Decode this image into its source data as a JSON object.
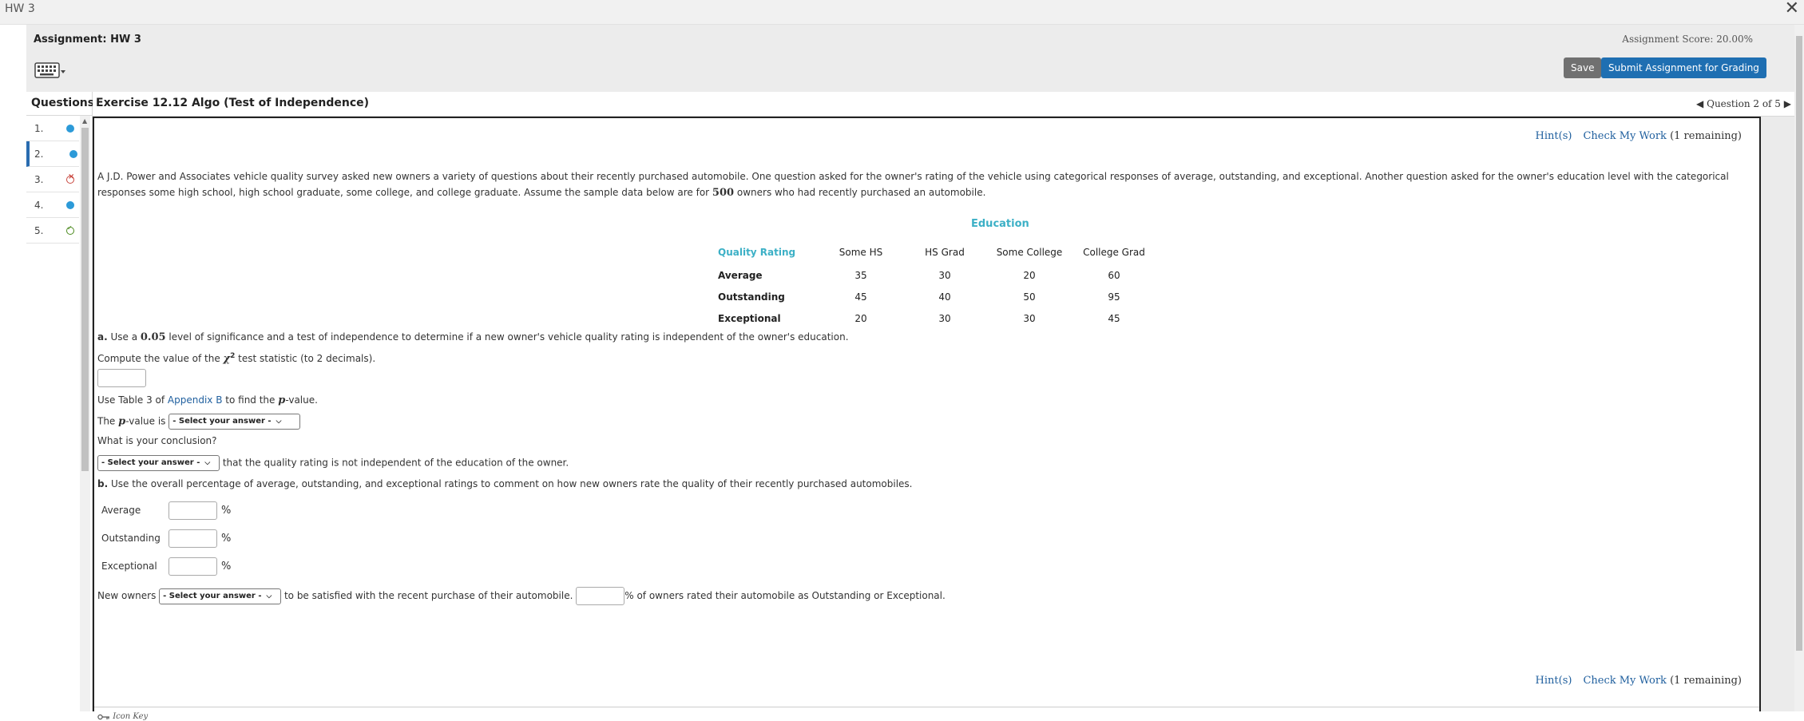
{
  "window": {
    "title": "HW 3",
    "close_glyph": "✕"
  },
  "assignment": {
    "title": "Assignment: HW 3",
    "score": "Assignment Score: 20.00%",
    "save_label": "Save",
    "submit_label": "Submit Assignment for Grading"
  },
  "sidebar": {
    "header": "Questions",
    "items": [
      {
        "num": "1.",
        "status": "blue"
      },
      {
        "num": "2.",
        "status": "blue"
      },
      {
        "num": "3.",
        "status": "incorrect"
      },
      {
        "num": "4.",
        "status": "blue"
      },
      {
        "num": "5.",
        "status": "correct"
      }
    ]
  },
  "exercise": {
    "title": "Exercise 12.12 Algo (Test of Independence)",
    "nav": "Question 2 of 5",
    "hints_label": "Hint(s)",
    "check_label": "Check My Work",
    "remaining": "(1 remaining)",
    "intro_1": "A J.D. Power and Associates vehicle quality survey asked new owners a variety of questions about their recently purchased automobile. One question asked for the owner's rating of the vehicle using categorical responses of average, outstanding, and exceptional. Another question asked for the owner's education level with the categorical",
    "intro_2a": "responses some high school, high school graduate, some college, and college graduate. Assume the sample data below are for ",
    "intro_2num": "500",
    "intro_2b": " owners who had recently purchased an automobile."
  },
  "table": {
    "group_label": "Education",
    "corner": "Quality Rating",
    "columns": [
      "Some HS",
      "HS Grad",
      "Some College",
      "College Grad"
    ],
    "rows": [
      {
        "label": "Average",
        "values": [
          "35",
          "30",
          "20",
          "60"
        ]
      },
      {
        "label": "Outstanding",
        "values": [
          "45",
          "40",
          "50",
          "95"
        ]
      },
      {
        "label": "Exceptional",
        "values": [
          "20",
          "30",
          "30",
          "45"
        ]
      }
    ]
  },
  "part_a": {
    "label": "a.",
    "text_1": " Use a ",
    "alpha": "0.05",
    "text_2": " level of significance and a test of independence to determine if a new owner's vehicle quality rating is independent of the owner's education.",
    "compute_1": "Compute the value of the ",
    "chi": "χ",
    "chi_sup": "2",
    "compute_2": " test statistic (to 2 decimals).",
    "table_1": "Use Table 3 of ",
    "appendix": "Appendix B",
    "table_2": " to find the ",
    "p": "p",
    "table_3": "-value.",
    "pv_1": "The ",
    "pv_2": "-value is ",
    "select_placeholder": "- Select your answer -",
    "conclusion_q": "What is your conclusion?",
    "conclusion_tail": " that the quality rating is not independent of the education of the owner."
  },
  "part_b": {
    "label": "b.",
    "text": " Use the overall percentage of average, outstanding, and exceptional ratings to comment on how new owners rate the quality of their recently purchased automobiles.",
    "rows": [
      "Average",
      "Outstanding",
      "Exceptional"
    ],
    "pct": "%",
    "new_owners": "New owners ",
    "satisfied": " to be satisfied with the recent purchase of their automobile. ",
    "rated": "% of owners rated their automobile as Outstanding or Exceptional."
  },
  "icon_key": "Icon Key"
}
